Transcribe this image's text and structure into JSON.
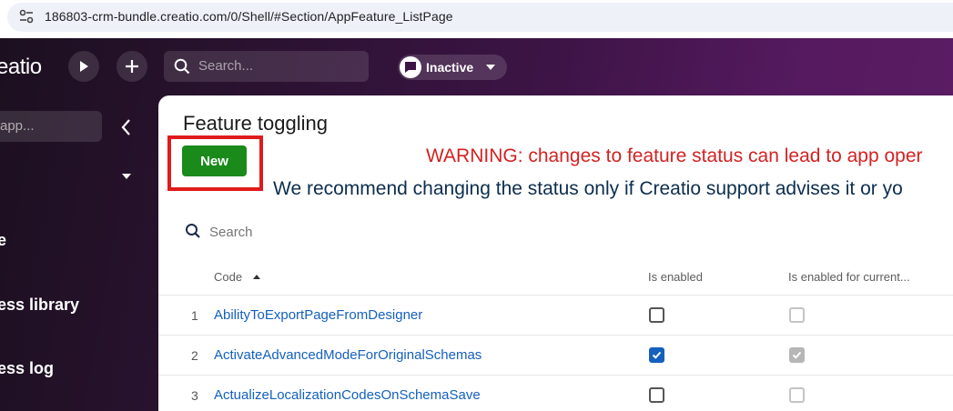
{
  "browser": {
    "url": "186803-crm-bundle.creatio.com/0/Shell/#Section/AppFeature_ListPage"
  },
  "header": {
    "logo_text": "eatio",
    "search_placeholder": "Search...",
    "status_label": "Inactive"
  },
  "sidebar": {
    "search_placeholder": "app...",
    "items": [
      {
        "label": "e"
      },
      {
        "label": "ess library"
      },
      {
        "label": "ess log"
      }
    ]
  },
  "main": {
    "title": "Feature toggling",
    "new_button_label": "New",
    "warning_text": "WARNING: changes to feature status can lead to app oper",
    "recommend_text": "We recommend changing the status only if Creatio support advises it or yo",
    "search_placeholder": "Search",
    "columns": {
      "code": "Code",
      "is_enabled": "Is enabled",
      "is_enabled_current": "Is enabled for current..."
    },
    "rows": [
      {
        "num": "1",
        "code": "AbilityToExportPageFromDesigner",
        "is_enabled": false,
        "is_enabled_current": false
      },
      {
        "num": "2",
        "code": "ActivateAdvancedModeForOriginalSchemas",
        "is_enabled": true,
        "is_enabled_current": true
      },
      {
        "num": "3",
        "code": "ActualizeLocalizationCodesOnSchemaSave",
        "is_enabled": false,
        "is_enabled_current": false
      }
    ]
  },
  "colors": {
    "accent_green": "#1a8a1a",
    "link_blue": "#1560bd",
    "warning_red": "#d32222",
    "highlight_red": "#e01b1b"
  }
}
